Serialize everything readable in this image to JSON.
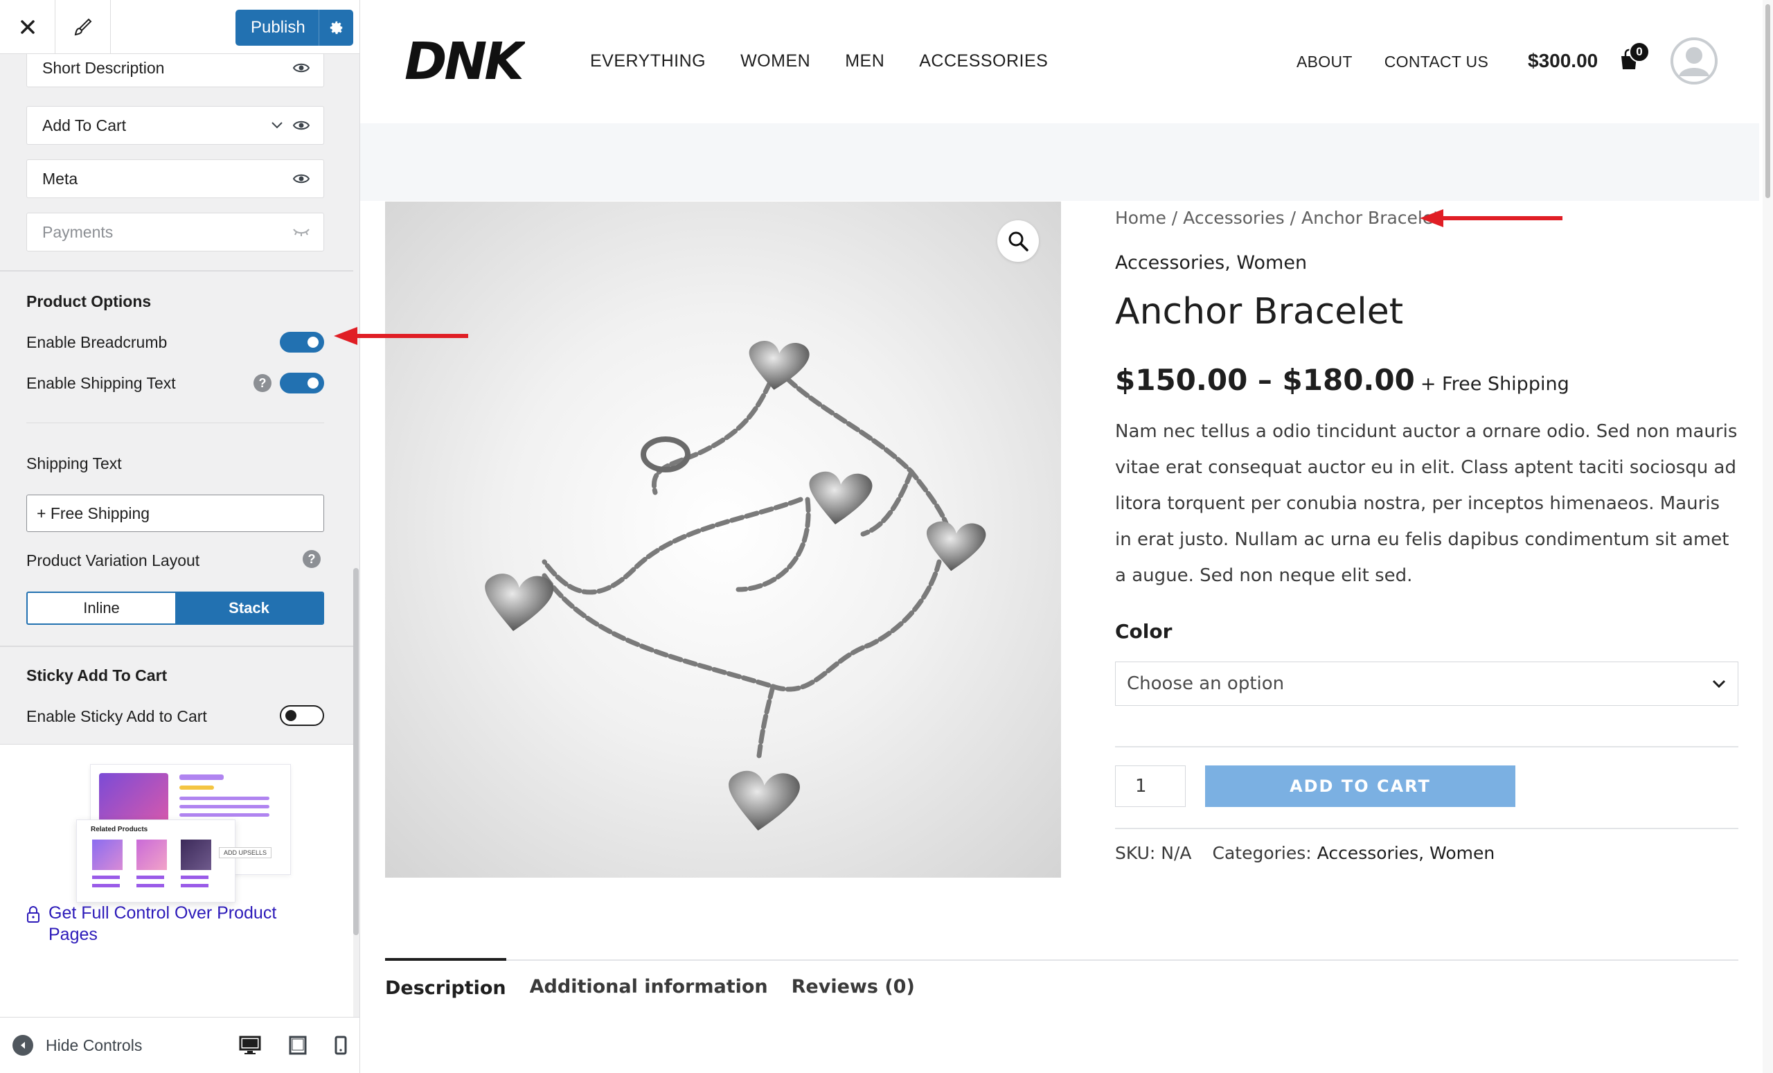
{
  "customizer": {
    "publish_label": "Publish",
    "elements": [
      {
        "label": "Short Description",
        "visible": true
      },
      {
        "label": "Add To Cart",
        "visible": true
      },
      {
        "label": "Meta",
        "visible": true
      },
      {
        "label": "Payments",
        "visible": false
      }
    ],
    "product_options": {
      "title": "Product Options",
      "enable_breadcrumb": {
        "label": "Enable Breadcrumb",
        "on": true
      },
      "enable_shipping_text": {
        "label": "Enable Shipping Text",
        "on": true
      },
      "shipping_text_label": "Shipping Text",
      "shipping_text_value": "+ Free Shipping",
      "variation_layout_label": "Product Variation Layout",
      "variation_layout_options": [
        "Inline",
        "Stack"
      ],
      "variation_layout_selected": "Stack"
    },
    "sticky": {
      "title": "Sticky Add To Cart",
      "enable_label": "Enable Sticky Add to Cart",
      "on": false
    },
    "upsell": {
      "related_label": "Related Products",
      "add_upsells_label": "ADD UPSELLS"
    },
    "pro_link": "Get Full Control Over Product Pages",
    "footer": {
      "hide_controls": "Hide Controls"
    },
    "accent_color": "#2271b1"
  },
  "site": {
    "logo": "DNK",
    "nav_main": [
      "EVERYTHING",
      "WOMEN",
      "MEN",
      "ACCESSORIES"
    ],
    "nav_right": [
      "ABOUT",
      "CONTACT US"
    ],
    "cart_total": "$300.00",
    "cart_count": "0"
  },
  "product": {
    "breadcrumb": [
      "Home",
      "Accessories",
      "Anchor Bracelet"
    ],
    "categories": "Accessories, Women",
    "title": "Anchor Bracelet",
    "price": "$150.00 – $180.00",
    "shipping_text": "+ Free Shipping",
    "description": "Nam nec tellus a odio tincidunt auctor a ornare odio. Sed non mauris vitae erat consequat auctor eu in elit. Class aptent taciti sociosqu ad litora torquent per conubia nostra, per inceptos himenaeos. Mauris in erat justo. Nullam ac urna eu felis dapibus condimentum sit amet a augue. Sed non neque elit sed.",
    "color_label": "Color",
    "color_placeholder": "Choose an option",
    "quantity": "1",
    "add_to_cart": "ADD TO CART",
    "sku_label": "SKU:",
    "sku_value": "N/A",
    "categories_label": "Categories:",
    "categories_value": "Accessories, Women",
    "tabs": [
      "Description",
      "Additional information",
      "Reviews (0)"
    ],
    "active_tab": "Description",
    "button_color": "#7bb0e2"
  },
  "annotation_color": "#e01e25"
}
